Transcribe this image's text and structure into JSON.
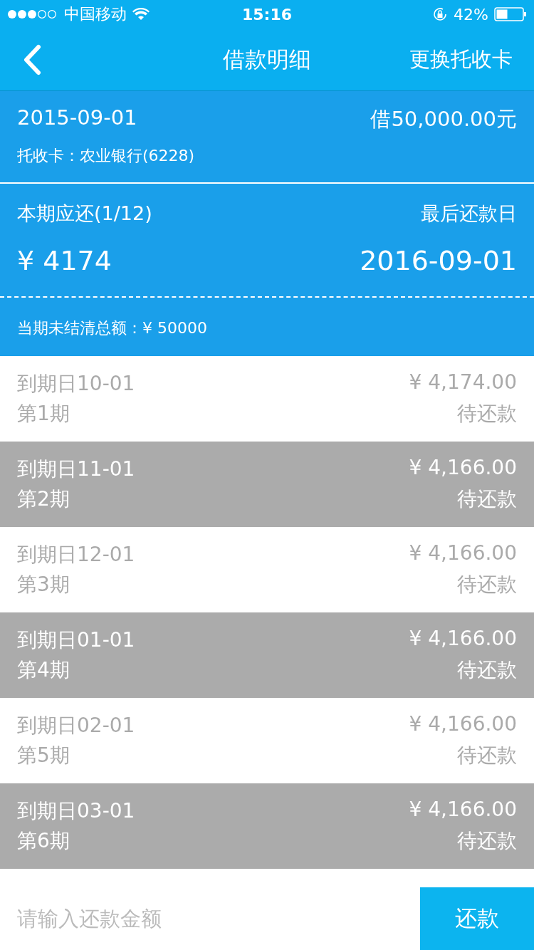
{
  "status_bar": {
    "carrier": "中国移动",
    "time": "15:16",
    "battery": "42%"
  },
  "nav": {
    "title": "借款明细",
    "action": "更换托收卡"
  },
  "loan": {
    "date": "2015-09-01",
    "amount": "借50,000.00元",
    "card": "托收卡：农业银行(6228)"
  },
  "current": {
    "label": "本期应还(1/12)",
    "amount": "¥ 4174",
    "last_label": "最后还款日",
    "last_date": "2016-09-01",
    "outstanding": "当期未结清总额：¥  50000"
  },
  "installments": [
    {
      "due": "到期日10-01",
      "period": "第1期",
      "amount": "¥ 4,174.00",
      "status": "待还款"
    },
    {
      "due": "到期日11-01",
      "period": "第2期",
      "amount": "¥ 4,166.00",
      "status": "待还款"
    },
    {
      "due": "到期日12-01",
      "period": "第3期",
      "amount": "¥ 4,166.00",
      "status": "待还款"
    },
    {
      "due": "到期日01-01",
      "period": "第4期",
      "amount": "¥ 4,166.00",
      "status": "待还款"
    },
    {
      "due": "到期日02-01",
      "period": "第5期",
      "amount": "¥ 4,166.00",
      "status": "待还款"
    },
    {
      "due": "到期日03-01",
      "period": "第6期",
      "amount": "¥ 4,166.00",
      "status": "待还款"
    }
  ],
  "repay": {
    "placeholder": "请输入还款金额",
    "button": "还款"
  }
}
